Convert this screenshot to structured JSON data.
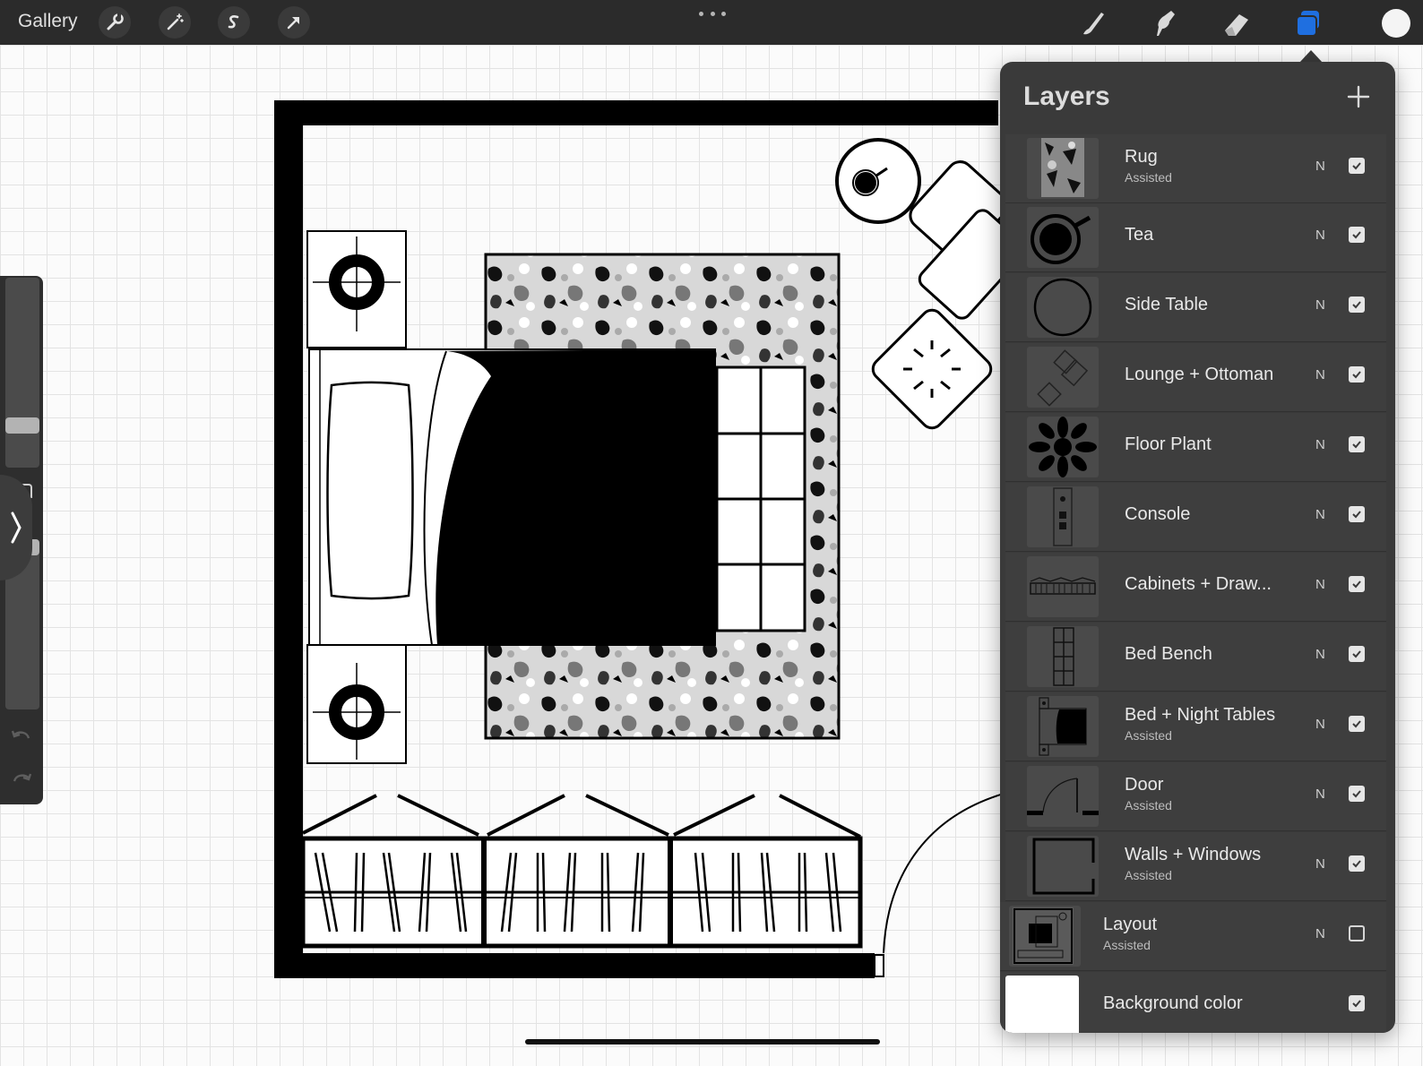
{
  "topbar": {
    "gallery_label": "Gallery",
    "left_tools": [
      "wrench-icon",
      "magic-wand-icon",
      "selection-s-icon",
      "transform-arrow-icon"
    ],
    "right_tools": [
      "brush-icon",
      "smudge-icon",
      "eraser-icon",
      "layers-icon"
    ],
    "active_tool": "layers-icon",
    "active_color": "#1f6fe0",
    "current_color": "#f4f4f4"
  },
  "layers_panel": {
    "title": "Layers",
    "layers": [
      {
        "name": "Rug",
        "sub": "Assisted",
        "blend": "N",
        "visible": true
      },
      {
        "name": "Tea",
        "sub": "",
        "blend": "N",
        "visible": true
      },
      {
        "name": "Side Table",
        "sub": "",
        "blend": "N",
        "visible": true
      },
      {
        "name": "Lounge + Ottoman",
        "sub": "",
        "blend": "N",
        "visible": true
      },
      {
        "name": "Floor Plant",
        "sub": "",
        "blend": "N",
        "visible": true
      },
      {
        "name": "Console",
        "sub": "",
        "blend": "N",
        "visible": true
      },
      {
        "name": "Cabinets + Draw...",
        "sub": "",
        "blend": "N",
        "visible": true
      },
      {
        "name": "Bed Bench",
        "sub": "",
        "blend": "N",
        "visible": true
      },
      {
        "name": "Bed + Night Tables",
        "sub": "Assisted",
        "blend": "N",
        "visible": true
      },
      {
        "name": "Door",
        "sub": "Assisted",
        "blend": "N",
        "visible": true
      },
      {
        "name": "Walls + Windows",
        "sub": "Assisted",
        "blend": "N",
        "visible": true
      },
      {
        "name": "Layout",
        "sub": "Assisted",
        "blend": "N",
        "visible": false
      },
      {
        "name": "Background color",
        "sub": "",
        "blend": "",
        "visible": true
      }
    ]
  }
}
